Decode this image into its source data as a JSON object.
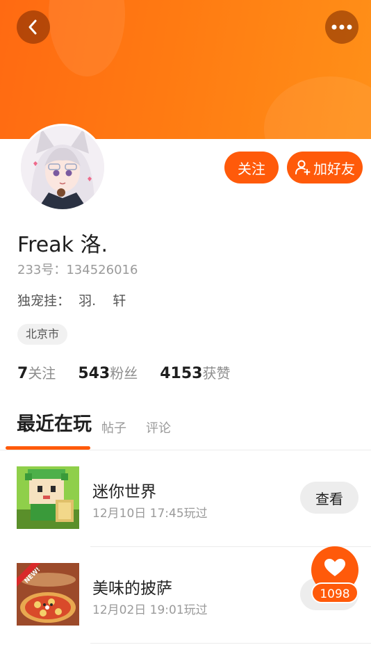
{
  "profile": {
    "name": "Freak 洛.",
    "uid": "233号：134526016",
    "bio": "独宠挂：  羽.    轩",
    "location": "北京市"
  },
  "actions": {
    "follow": "关注",
    "add_friend": "加好友"
  },
  "stats": [
    {
      "num": "7",
      "label": "关注"
    },
    {
      "num": "543",
      "label": "粉丝"
    },
    {
      "num": "4153",
      "label": "获赞"
    }
  ],
  "tabs": [
    {
      "label": "最近在玩"
    },
    {
      "label": "帖子"
    },
    {
      "label": "评论"
    }
  ],
  "games": [
    {
      "name": "迷你世界",
      "time": "12月10日 17:45玩过",
      "button": "查看"
    },
    {
      "name": "美味的披萨",
      "time": "12月02日 19:01玩过",
      "button": "查看",
      "badge": "NEW!"
    }
  ],
  "like_fab": {
    "count": "1098"
  },
  "icons": [
    "back-icon",
    "more-icon",
    "add-user-icon",
    "heart-icon"
  ],
  "colors": {
    "accent": "#ff5a0a",
    "banner": "#ff7a12"
  }
}
